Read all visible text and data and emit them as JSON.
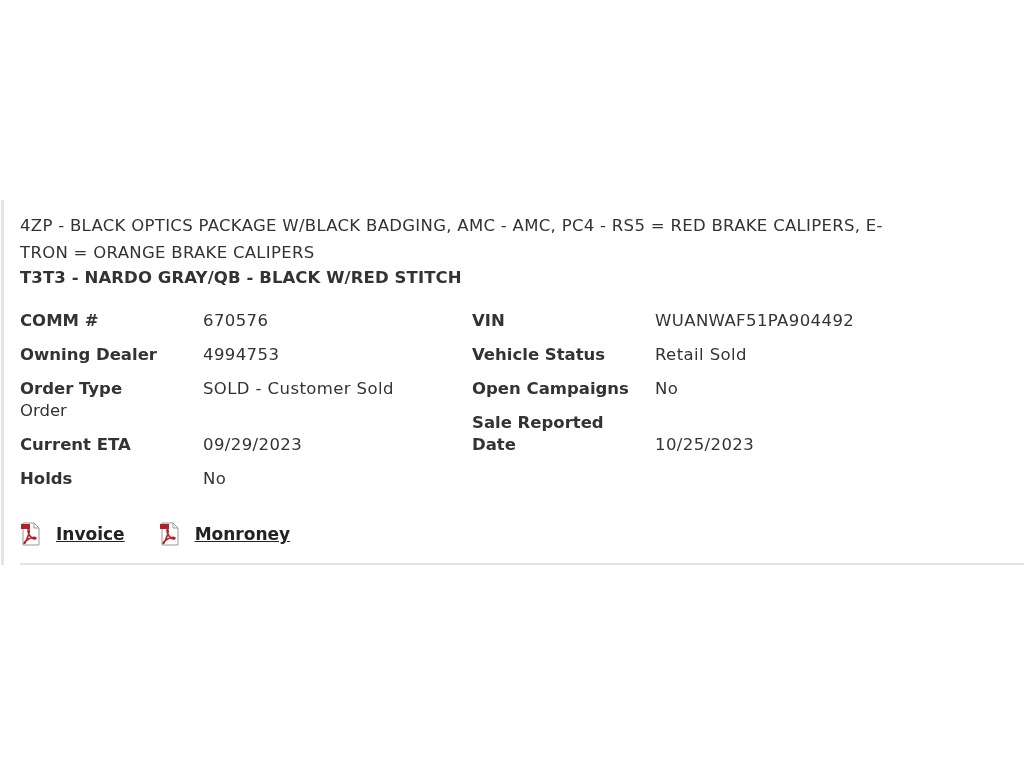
{
  "description": "4ZP - BLACK OPTICS PACKAGE W/BLACK BADGING, AMC - AMC, PC4 - RS5 = RED BRAKE CALIPERS, E-TRON = ORANGE BRAKE CALIPERS",
  "color_code": "T3T3 - NARDO GRAY/QB - BLACK W/RED STITCH",
  "left_fields": [
    {
      "label": "COMM #",
      "value": "670576"
    },
    {
      "label": "Owning Dealer",
      "value": "4994753"
    },
    {
      "label": "Order Type",
      "note": "Order",
      "value": "SOLD - Customer Sold"
    },
    {
      "label": "Current ETA",
      "value": "09/29/2023"
    },
    {
      "label": "Holds",
      "value": "No"
    }
  ],
  "right_fields": [
    {
      "label": "VIN",
      "value": "WUANWAF51PA904492"
    },
    {
      "label": "Vehicle Status",
      "value": "Retail Sold"
    },
    {
      "label": "Open Campaigns",
      "value": "No"
    },
    {
      "label": "Sale Reported Date",
      "value": "10/25/2023"
    }
  ],
  "documents": [
    {
      "label": "Invoice",
      "kind": "pdf"
    },
    {
      "label": "Monroney",
      "kind": "pdf"
    }
  ]
}
